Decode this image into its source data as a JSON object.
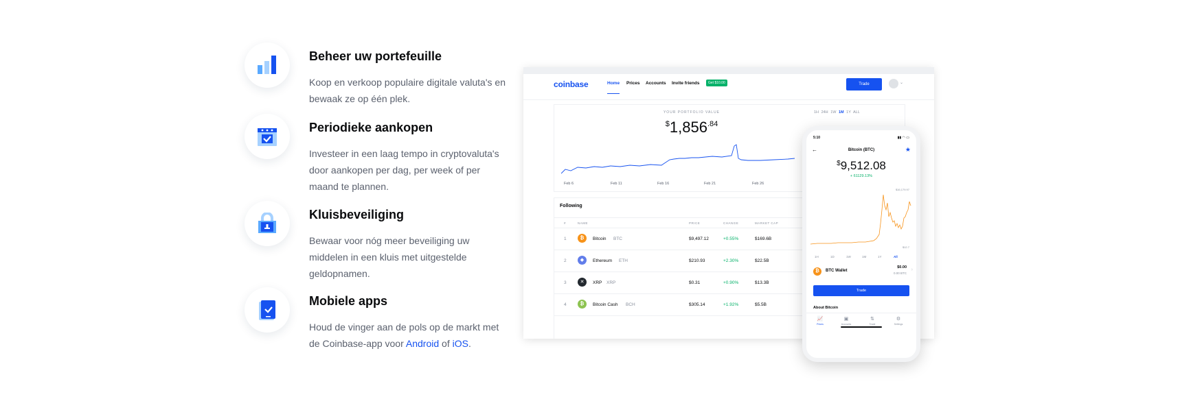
{
  "features": [
    {
      "title": "Beheer uw portefeuille",
      "desc": "Koop en verkoop populaire digitale valuta's en bewaak ze op één plek.",
      "icon": "bar-chart-icon"
    },
    {
      "title": "Periodieke aankopen",
      "desc": "Investeer in een laag tempo in cryptovaluta's door aankopen per dag, per week of per maand te plannen.",
      "icon": "calendar-check-icon"
    },
    {
      "title": "Kluisbeveiliging",
      "desc": "Bewaar voor nóg meer beveiliging uw middelen in een kluis met uitgestelde geldopnamen.",
      "icon": "vault-lock-icon"
    },
    {
      "title": "Mobiele apps",
      "desc_before": "Houd de vinger aan de pols op de markt met de Coinbase-app voor ",
      "link_android": "Android",
      "desc_mid": " of ",
      "link_ios": "iOS",
      "desc_after": ".",
      "icon": "mobile-phone-icon"
    }
  ],
  "desktop": {
    "logo": "coinbase",
    "nav": {
      "home": "Home",
      "prices": "Prices",
      "accounts": "Accounts",
      "invite": "Invite friends",
      "badge": "Get $10.00"
    },
    "trade": "Trade",
    "portfolio_label": "YOUR PORTFOLIO VALUE",
    "portfolio_main": "1,856",
    "portfolio_cents": ".84",
    "currency": "$",
    "ranges": [
      "1H",
      "24H",
      "1W",
      "1M",
      "1Y",
      "ALL"
    ],
    "x_labels": [
      "Feb 6",
      "Feb 11",
      "Feb 16",
      "Feb 21",
      "Feb 26"
    ],
    "following": "Following",
    "columns": {
      "num": "#",
      "name": "NAME",
      "price": "PRICE",
      "change": "CHANGE",
      "cap": "MARKET CAP"
    },
    "rows": [
      {
        "num": "1",
        "name": "Bitcoin",
        "ticker": "BTC",
        "price": "$9,497.12",
        "change": "+0.55%",
        "cap": "$169.6B",
        "color": "#f7931a",
        "glyph": "₿"
      },
      {
        "num": "2",
        "name": "Ethereum",
        "ticker": "ETH",
        "price": "$210.93",
        "change": "+2.30%",
        "cap": "$22.5B",
        "color": "#627eea",
        "glyph": "◆"
      },
      {
        "num": "3",
        "name": "XRP",
        "ticker": "XRP",
        "price": "$0.31",
        "change": "+0.90%",
        "cap": "$13.3B",
        "color": "#23292f",
        "glyph": "✕"
      },
      {
        "num": "4",
        "name": "Bitcoin Cash",
        "ticker": "BCH",
        "price": "$305.14",
        "change": "+1.92%",
        "cap": "$5.5B",
        "color": "#8dc351",
        "glyph": "₿"
      }
    ]
  },
  "phone": {
    "time": "5:10",
    "title": "Bitcoin (BTC)",
    "currency": "$",
    "price": "9,512.08",
    "change": "+ 61129.13%",
    "high": "$16,179.97",
    "low": "$12.7",
    "ranges": [
      "1H",
      "1D",
      "1W",
      "1M",
      "1Y",
      "All"
    ],
    "wallet": "BTC Wallet",
    "wallet_usd": "$0.00",
    "wallet_btc": "0.00 BTC",
    "trade": "Trade",
    "about": "About Bitcoin",
    "tabs": [
      "Prices",
      "Accounts",
      "Trade",
      "Settings"
    ]
  }
}
